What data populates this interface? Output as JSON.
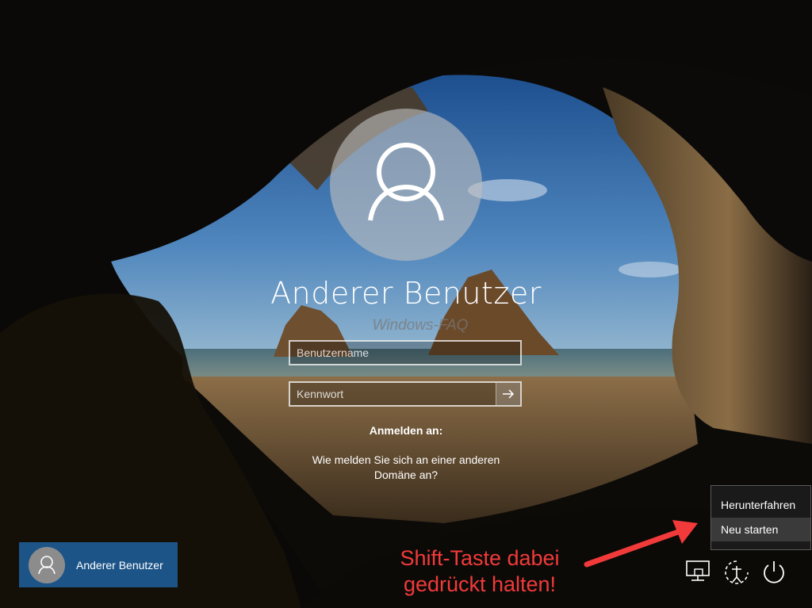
{
  "login": {
    "user_name": "Anderer Benutzer",
    "watermark": "Windows-FAQ",
    "username_placeholder": "Benutzername",
    "password_placeholder": "Kennwort",
    "sign_in_to": "Anmelden an:",
    "domain_help": "Wie melden Sie sich an einer anderen Domäne an?"
  },
  "user_tile": {
    "label": "Anderer Benutzer"
  },
  "power_menu": {
    "items": [
      {
        "label": "Herunterfahren"
      },
      {
        "label": "Neu starten"
      }
    ]
  },
  "annotation": {
    "text": "Shift-Taste dabei gedrückt halten!",
    "color": "#f23a3a"
  },
  "system_icons": [
    "network-icon",
    "ease-of-access-icon",
    "power-icon"
  ],
  "colors": {
    "user_tile_bg": "#1c5488",
    "menu_bg": "#1a1a1a",
    "menu_selected_bg": "#3a3a3a"
  }
}
